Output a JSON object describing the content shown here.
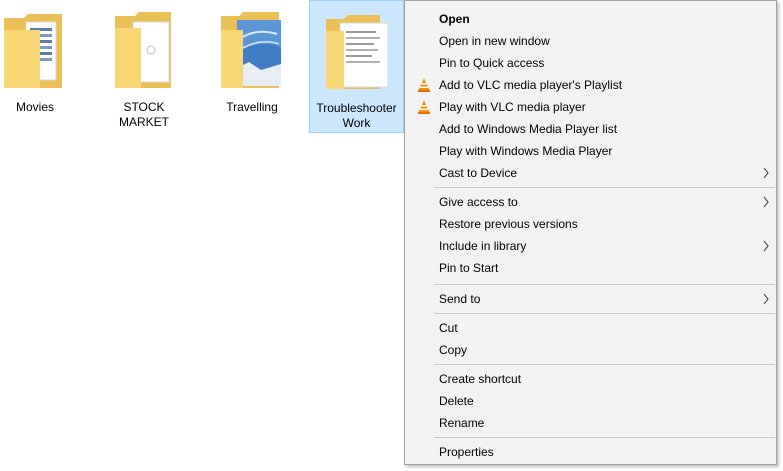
{
  "folders": [
    {
      "name": "Movies"
    },
    {
      "name": "STOCK MARKET"
    },
    {
      "name": "Travelling"
    },
    {
      "name": "Troubleshooter\nWork"
    }
  ],
  "menu": {
    "items": [
      {
        "label": "Open"
      },
      {
        "label": "Open in new window"
      },
      {
        "label": "Pin to Quick access"
      },
      {
        "label": "Add to VLC media player's Playlist",
        "icon": "vlc-icon"
      },
      {
        "label": "Play with VLC media player",
        "icon": "vlc-icon"
      },
      {
        "label": "Add to Windows Media Player list"
      },
      {
        "label": "Play with Windows Media Player"
      },
      {
        "label": "Cast to Device",
        "submenu": true
      },
      {
        "label": "Give access to",
        "submenu": true
      },
      {
        "label": "Restore previous versions"
      },
      {
        "label": "Include in library",
        "submenu": true
      },
      {
        "label": "Pin to Start"
      },
      {
        "label": "Send to",
        "submenu": true
      },
      {
        "label": "Cut"
      },
      {
        "label": "Copy"
      },
      {
        "label": "Create shortcut"
      },
      {
        "label": "Delete"
      },
      {
        "label": "Rename"
      },
      {
        "label": "Properties"
      }
    ]
  },
  "colors": {
    "selection_bg": "#cce8ff",
    "menu_bg": "#f2f2f2",
    "folder_yellow": "#f8d775",
    "vlc_orange": "#f48a00"
  }
}
